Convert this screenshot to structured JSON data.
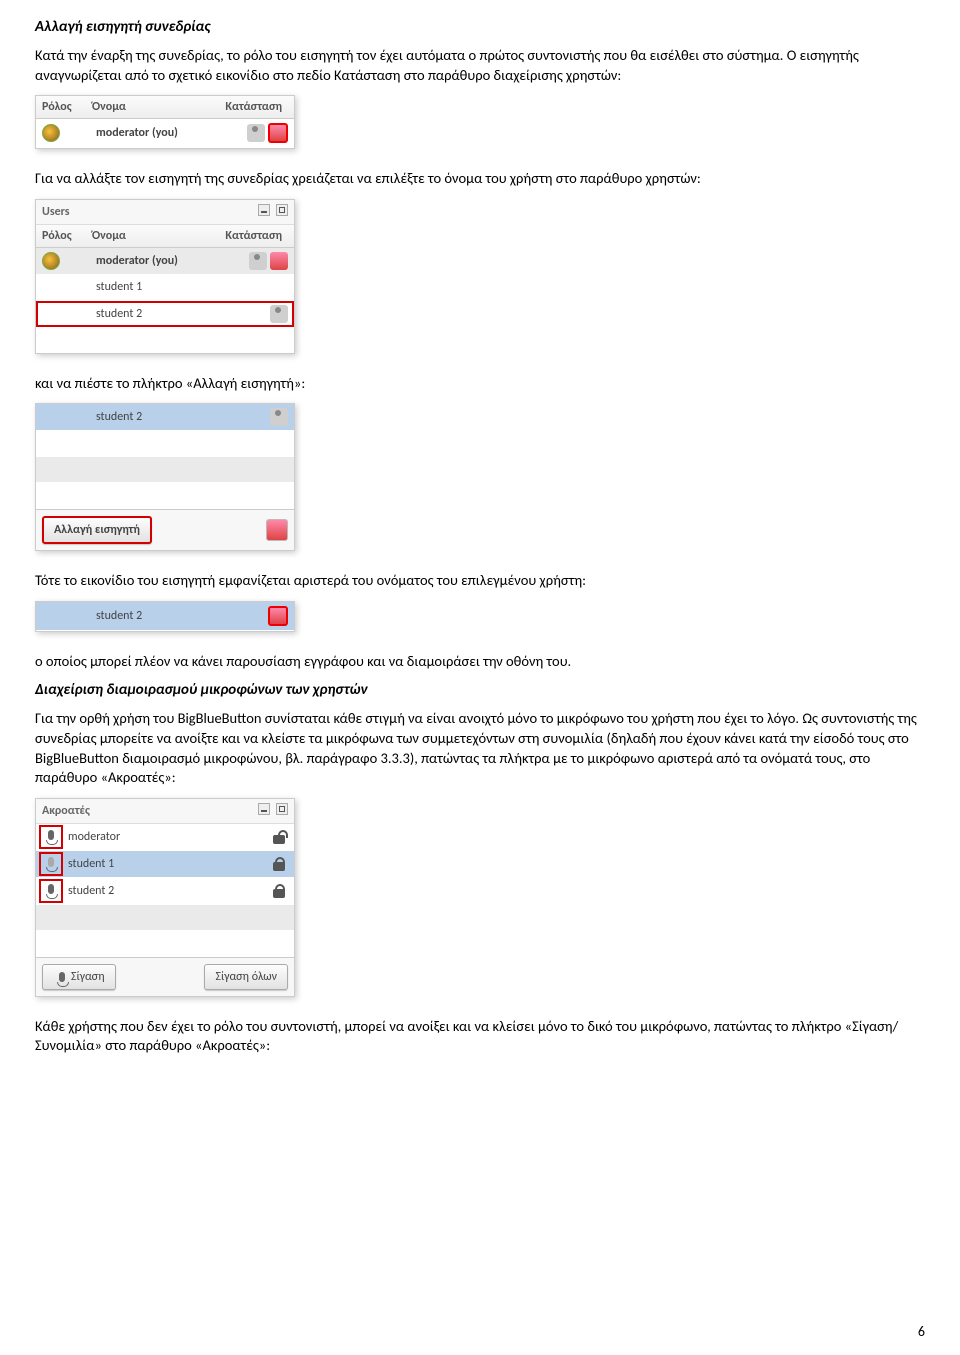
{
  "section1": {
    "title": "Αλλαγή εισηγητή συνεδρίας",
    "p1": "Κατά την έναρξη της συνεδρίας, το ρόλο του εισηγητή τον έχει αυτόματα ο πρώτος συντονιστής που θα εισέλθει στο σύστημα. Ο εισηγητής αναγνωρίζεται από το σχετικό εικονίδιο στο πεδίο Κατάσταση στο παράθυρο διαχείρισης χρηστών:"
  },
  "panel1": {
    "head_role": "Ρόλος",
    "head_name": "Όνομα",
    "head_status": "Κατάσταση",
    "row1_name": "moderator (you)"
  },
  "section1b": {
    "p1": "Για να αλλάξτε τον εισηγητή της συνεδρίας χρειάζεται να επιλέξτε το όνομα του χρήστη στο παράθυρο χρηστών:"
  },
  "panel2": {
    "title": "Users",
    "head_role": "Ρόλος",
    "head_name": "Όνομα",
    "head_status": "Κατάσταση",
    "r1": "moderator (you)",
    "r2": "student 1",
    "r3": "student 2"
  },
  "section1c": {
    "p1": "και να πιέστε το πλήκτρο «Αλλαγή εισηγητή»:"
  },
  "panel3": {
    "r1": "student 2",
    "button": "Αλλαγή εισηγητή"
  },
  "section1d": {
    "p1": "Τότε το εικονίδιο του εισηγητή εμφανίζεται αριστερά του ονόματος του επιλεγμένου χρήστη:"
  },
  "panel4": {
    "r1": "student 2"
  },
  "section1e": {
    "p1": "ο οποίος μπορεί πλέον να κάνει παρουσίαση εγγράφου και να διαμοιράσει την οθόνη του."
  },
  "section2": {
    "title": "Διαχείριση διαμοιρασμού μικροφώνων των χρηστών",
    "p1": "Για την ορθή χρήση του BigBlueButton συνίσταται κάθε στιγμή να είναι ανοιχτό μόνο το μικρόφωνο του χρήστη που έχει το λόγο. Ως συντονιστής της συνεδρίας μπορείτε να ανοίξτε και να κλείστε τα μικρόφωνα των  συμμετεχόντων στη συνομιλία (δηλαδή που έχουν κάνει κατά την είσοδό τους στο BigBlueButton διαμοιρασμό μικροφώνου, βλ. παράγραφο 3.3.3), πατώντας τα πλήκτρα με το μικρόφωνο αριστερά από τα ονόματά τους, στο παράθυρο «Ακροατές»:"
  },
  "panel5": {
    "title": "Ακροατές",
    "r1": "moderator",
    "r2": "student 1",
    "r3": "student 2",
    "btn_mute": "Σίγαση",
    "btn_mute_all": "Σίγαση όλων"
  },
  "section2b": {
    "p1": "Κάθε χρήστης που δεν έχει το ρόλο του συντονιστή, μπορεί να ανοίξει και να κλείσει μόνο το δικό του μικρόφωνο, πατώντας το πλήκτρο «Σίγαση/Συνομιλία» στο παράθυρο «Ακροατές»:"
  },
  "page_number": "6"
}
